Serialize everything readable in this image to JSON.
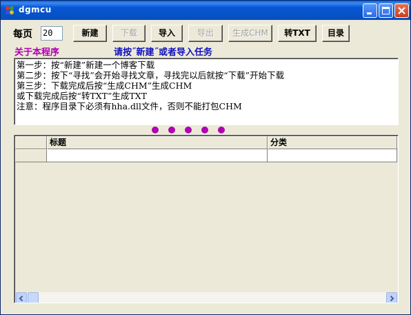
{
  "window": {
    "title": "dgmcu"
  },
  "toolbar": {
    "per_page_label": "每页",
    "per_page_value": "20",
    "buttons": [
      {
        "label": "新建",
        "enabled": true
      },
      {
        "label": "下载",
        "enabled": false
      },
      {
        "label": "导入",
        "enabled": true
      },
      {
        "label": "导出",
        "enabled": false
      },
      {
        "label": "生成CHM",
        "enabled": false
      },
      {
        "label": "转TXT",
        "enabled": true
      },
      {
        "label": "目录",
        "enabled": true
      }
    ]
  },
  "about_link": "关于本程序",
  "hint_text": "请按˝新建˝或者导入任务",
  "instructions": [
    "第一步：按“新建”新建一个博客下载",
    "第二步：按下“寻找”会开始寻找文章，寻找完以后就按“下载”开始下载",
    "第三步：下载完成后按“生成CHM”生成CHM",
    "或下载完成后按“转TXT”生成TXT",
    "注意：程序目录下必须有hha.dll文件，否则不能打包CHM"
  ],
  "grid": {
    "columns": [
      "标题",
      "分类"
    ],
    "rows": [
      [
        "",
        ""
      ]
    ]
  },
  "colors": {
    "about_link": "#b000b0",
    "hint": "#1010c0",
    "dots": "#b000b0",
    "titlebar": "#0553c8"
  },
  "icons": {
    "app": "app-icon",
    "minimize": "minimize-icon",
    "maximize": "maximize-icon",
    "close": "close-icon",
    "scroll_left": "arrow-left-icon",
    "scroll_right": "arrow-right-icon"
  }
}
